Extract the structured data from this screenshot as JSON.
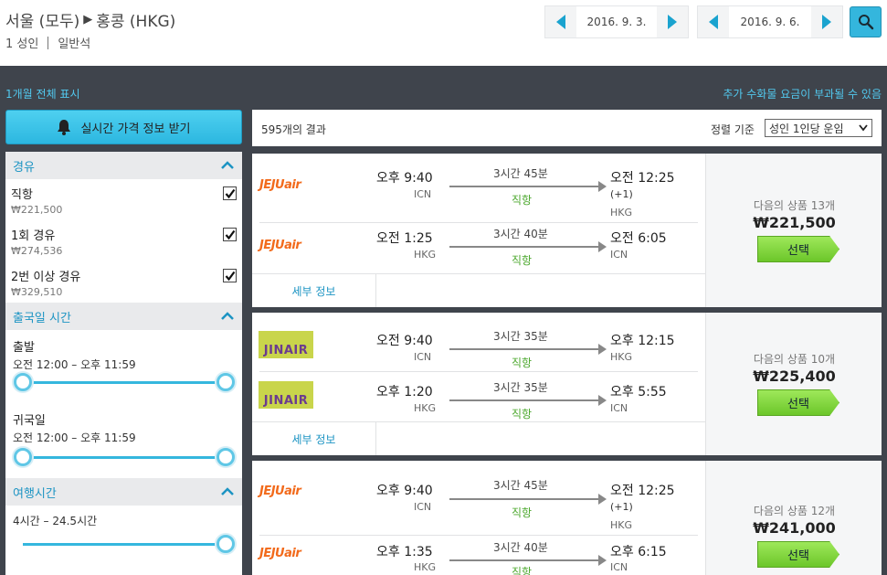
{
  "header": {
    "origin": "서울 (모두)",
    "destination": "홍콩 (HKG)",
    "passengers": "1 성인",
    "cabin": "일반석",
    "depart_date": "2016. 9. 3.",
    "return_date": "2016. 9. 6."
  },
  "links": {
    "month_view": "1개월 전체 표시",
    "notice": "추가 수화물 요금이 부과될 수 있음"
  },
  "alert_button": "실시간 가격 정보 받기",
  "filters": {
    "stops": {
      "title": "경유",
      "items": [
        {
          "label": "직항",
          "price": "₩221,500",
          "checked": true
        },
        {
          "label": "1회 경유",
          "price": "₩274,536",
          "checked": true
        },
        {
          "label": "2번 이상 경유",
          "price": "₩329,510",
          "checked": true
        }
      ]
    },
    "times": {
      "title": "출국일 시간",
      "outbound_label": "출발",
      "outbound_range": "오전 12:00 – 오후 11:59",
      "return_label": "귀국일",
      "return_range": "오전 12:00 – 오후 11:59"
    },
    "duration": {
      "title": "여행시간",
      "range": "4시간 – 24.5시간"
    }
  },
  "results": {
    "count": "595개의 결과",
    "sort_label": "정렬 기준",
    "sort_value": "성인 1인당 운임",
    "detail_label": "세부 정보",
    "select_label": "선택",
    "cards": [
      {
        "next_label": "다음의 상품 13개",
        "price": "₩221,500",
        "legs": [
          {
            "airline": "JEJUair",
            "dep_time": "오후 9:40",
            "dep_ap": "ICN",
            "duration": "3시간 45분",
            "stops": "직항",
            "arr_time": "오전 12:25",
            "plus": "(+1)",
            "arr_ap": "HKG"
          },
          {
            "airline": "JEJUair",
            "dep_time": "오전 1:25",
            "dep_ap": "HKG",
            "duration": "3시간 40분",
            "stops": "직항",
            "arr_time": "오전 6:05",
            "plus": "",
            "arr_ap": "ICN"
          }
        ]
      },
      {
        "next_label": "다음의 상품 10개",
        "price": "₩225,400",
        "legs": [
          {
            "airline": "JINAIR",
            "dep_time": "오전 9:40",
            "dep_ap": "ICN",
            "duration": "3시간 35분",
            "stops": "직항",
            "arr_time": "오후 12:15",
            "plus": "",
            "arr_ap": "HKG"
          },
          {
            "airline": "JINAIR",
            "dep_time": "오후 1:20",
            "dep_ap": "HKG",
            "duration": "3시간 35분",
            "stops": "직항",
            "arr_time": "오후 5:55",
            "plus": "",
            "arr_ap": "ICN"
          }
        ]
      },
      {
        "next_label": "다음의 상품 12개",
        "price": "₩241,000",
        "legs": [
          {
            "airline": "JEJUair",
            "dep_time": "오후 9:40",
            "dep_ap": "ICN",
            "duration": "3시간 45분",
            "stops": "직항",
            "arr_time": "오전 12:25",
            "plus": "(+1)",
            "arr_ap": "HKG"
          },
          {
            "airline": "JEJUair",
            "dep_time": "오후 1:35",
            "dep_ap": "HKG",
            "duration": "3시간 40분",
            "stops": "직항",
            "arr_time": "오후 6:15",
            "plus": "",
            "arr_ap": "ICN"
          }
        ]
      }
    ]
  },
  "colors": {
    "accent": "#34b6dd",
    "direct": "#4ca82e",
    "select": "#7fd13a",
    "jeju": "#f26a1b"
  }
}
